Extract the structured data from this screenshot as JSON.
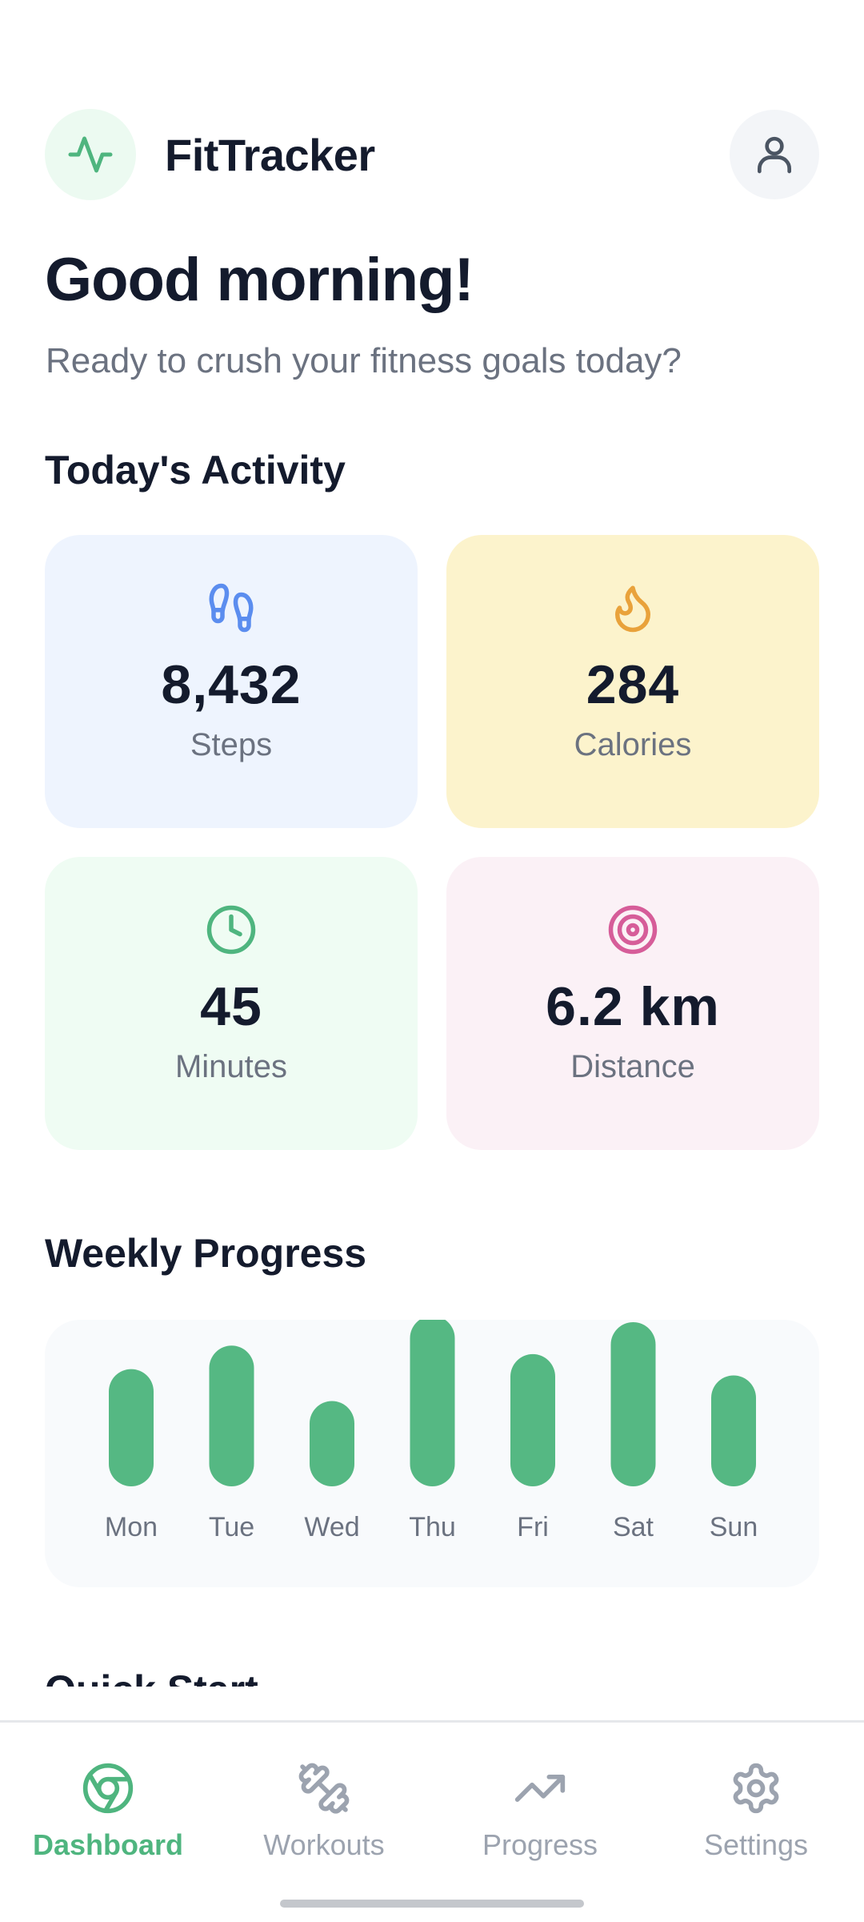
{
  "header": {
    "app_title": "FitTracker",
    "logo_icon": "activity-pulse-icon",
    "profile_icon": "user-icon"
  },
  "greeting": {
    "title": "Good morning!",
    "subtitle": "Ready to crush your fitness goals today?"
  },
  "activity": {
    "section_title": "Today's Activity",
    "cards": [
      {
        "value": "8,432",
        "label": "Steps",
        "icon": "footprints-icon",
        "bg": "#eef4fe",
        "accent": "#5b8def"
      },
      {
        "value": "284",
        "label": "Calories",
        "icon": "flame-icon",
        "bg": "#fcf3cc",
        "accent": "#e9a23b"
      },
      {
        "value": "45",
        "label": "Minutes",
        "icon": "clock-icon",
        "bg": "#effcf3",
        "accent": "#4fb57f"
      },
      {
        "value": "6.2 km",
        "label": "Distance",
        "icon": "target-icon",
        "bg": "#fbf1f6",
        "accent": "#d65d99"
      }
    ]
  },
  "weekly": {
    "section_title": "Weekly Progress"
  },
  "chart_data": {
    "type": "bar",
    "categories": [
      "Mon",
      "Tue",
      "Wed",
      "Thu",
      "Fri",
      "Sat",
      "Sun"
    ],
    "values": [
      55,
      66,
      40,
      80,
      62,
      77,
      52
    ],
    "ylim": [
      0,
      80
    ],
    "grid": false,
    "bar_color": "#55b883"
  },
  "quick_start": {
    "section_title": "Quick Start"
  },
  "nav": {
    "items": [
      {
        "label": "Dashboard",
        "icon": "dashboard-chrome-icon",
        "active": true
      },
      {
        "label": "Workouts",
        "icon": "dumbbell-icon",
        "active": false
      },
      {
        "label": "Progress",
        "icon": "trending-up-icon",
        "active": false
      },
      {
        "label": "Settings",
        "icon": "gear-icon",
        "active": false
      }
    ]
  },
  "colors": {
    "accent": "#4fb57f",
    "text": "#141b2d",
    "muted": "#6b7280",
    "nav_inactive": "#9ca3af"
  }
}
